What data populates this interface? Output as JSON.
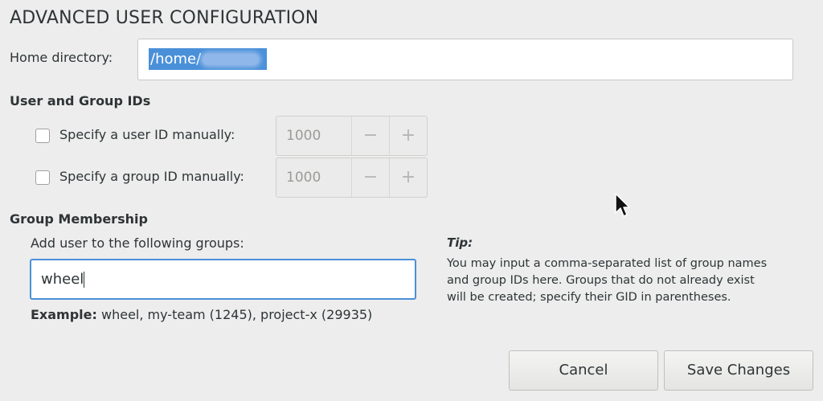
{
  "dialog": {
    "title": "ADVANCED USER CONFIGURATION"
  },
  "home": {
    "label": "Home directory:",
    "value_prefix": "/home/"
  },
  "ids": {
    "section_label": "User and Group IDs",
    "user_check_label": "Specify a user ID manually:",
    "group_check_label": "Specify a group ID manually:",
    "user_id_value": "1000",
    "group_id_value": "1000",
    "decrement_glyph": "−",
    "increment_glyph": "+"
  },
  "groups": {
    "section_label": "Group Membership",
    "field_label": "Add user to the following groups:",
    "value": "wheel",
    "example_label": "Example:",
    "example_text": "wheel, my-team (1245), project-x (29935)"
  },
  "tip": {
    "title": "Tip:",
    "body": "You may input a comma-separated list of group names and group IDs here. Groups that do not already exist will be created; specify their GID in parentheses."
  },
  "buttons": {
    "cancel": "Cancel",
    "save": "Save Changes"
  },
  "colors": {
    "selection": "#4a90d9",
    "focus": "#4a90d9",
    "background": "#ededed"
  }
}
